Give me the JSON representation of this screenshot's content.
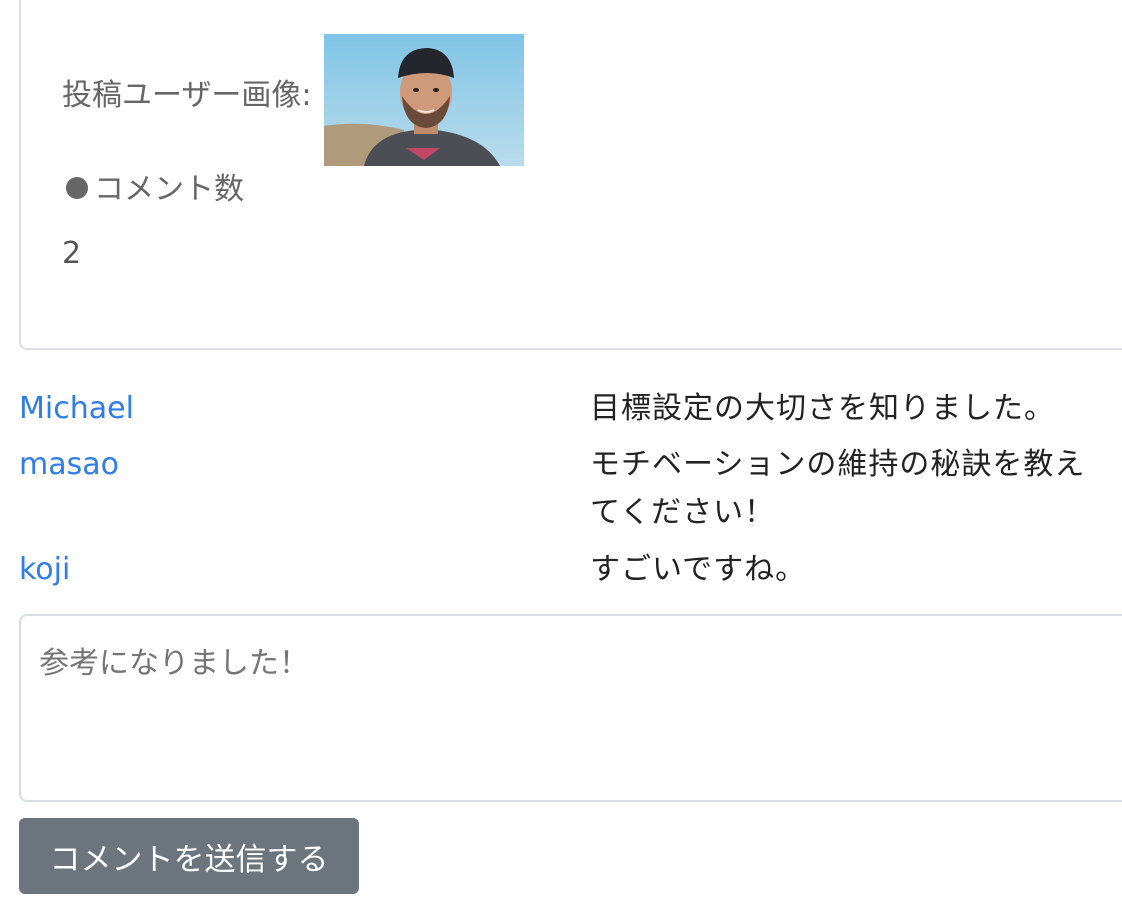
{
  "post": {
    "user_image_label": "投稿ユーザー画像:",
    "comment_count_heading": "コメント数",
    "comment_count_value": "2"
  },
  "comments": [
    {
      "user": "Michael",
      "text": "目標設定の大切さを知りました。"
    },
    {
      "user": "masao",
      "text": "モチベーションの維持の秘訣を教えてください！"
    },
    {
      "user": "koji",
      "text": "すごいですね。"
    }
  ],
  "form": {
    "comment_placeholder": "参考になりました！",
    "submit_label": "コメントを送信する"
  },
  "colors": {
    "link": "#2f7ee8",
    "button": "#6c757d"
  }
}
